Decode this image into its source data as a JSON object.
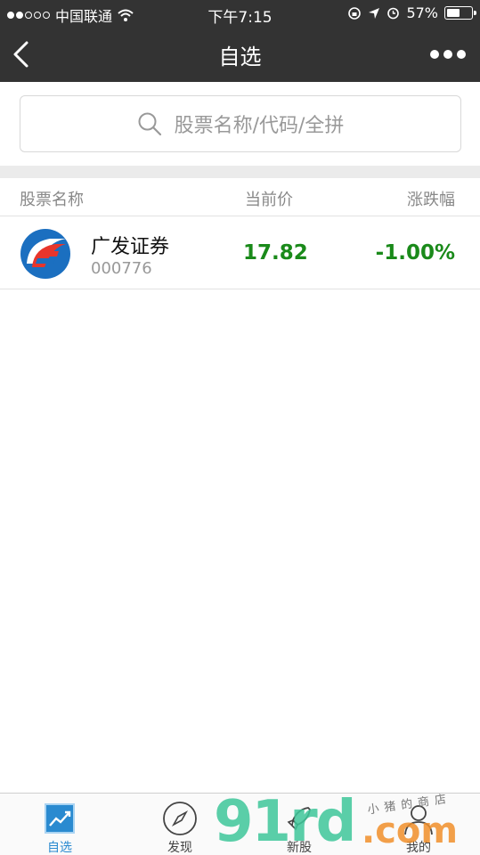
{
  "status_bar": {
    "carrier": "中国联通",
    "time": "下午7:15",
    "battery": "57%",
    "battery_level": 0.57
  },
  "nav": {
    "title": "自选"
  },
  "search": {
    "placeholder": "股票名称/代码/全拼"
  },
  "table": {
    "headers": [
      "股票名称",
      "当前价",
      "涨跌幅"
    ],
    "rows": [
      {
        "name": "广发证券",
        "code": "000776",
        "price": "17.82",
        "change": "-1.00%"
      }
    ]
  },
  "tabs": [
    {
      "label": "自选",
      "icon": "chart-trend-icon",
      "active": true
    },
    {
      "label": "发现",
      "icon": "compass-icon",
      "active": false
    },
    {
      "label": "新股",
      "icon": "rocket-icon",
      "active": false
    },
    {
      "label": "我的",
      "icon": "user-icon",
      "active": false
    }
  ],
  "watermark": {
    "brand": "91rd",
    "suffix": ".com",
    "tagline": "小猪的商店"
  },
  "colors": {
    "nav_bg": "#333333",
    "price_down": "#1a8a1a",
    "tab_active": "#2a8ad0"
  }
}
